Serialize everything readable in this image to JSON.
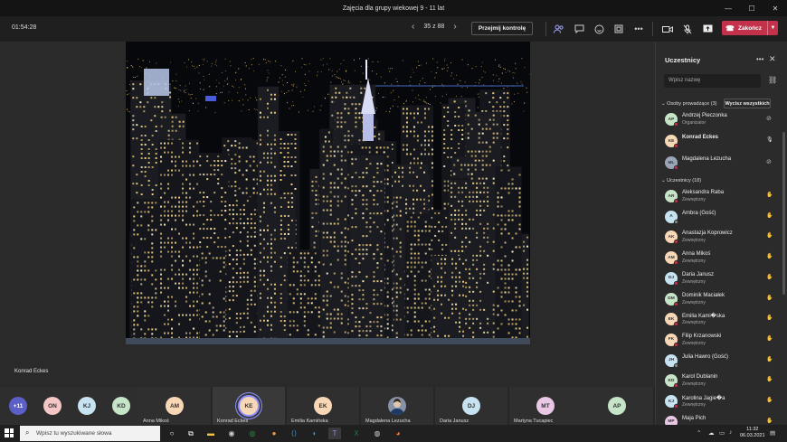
{
  "window": {
    "title": "Zajęcia dla grupy wiekowej 9 - 11 lat",
    "controls": {
      "minimize": "—",
      "maximize": "☐",
      "close": "✕"
    }
  },
  "toolbar": {
    "timer": "01:54:28",
    "page_indicator": "35 z 88",
    "take_control": "Przejmij kontrolę",
    "leave_label": "Zakończ",
    "colors": {
      "leave": "#c4314b"
    }
  },
  "stage": {
    "presenter_name": "Konrad Eckes"
  },
  "gallery": {
    "overflow": [
      {
        "initials": "+11",
        "color": "#5b5fc7"
      },
      {
        "initials": "ON",
        "color": "#f4c6c6"
      },
      {
        "initials": "KJ",
        "color": "#c7e2f0"
      },
      {
        "initials": "KD",
        "color": "#c6e4c8"
      }
    ],
    "tiles": [
      {
        "initials": "AM",
        "name": "Anna Mikoś",
        "color": "#f7d7b5"
      },
      {
        "initials": "KE",
        "name": "Konrad Eckes",
        "color": "#f7d7b5"
      },
      {
        "initials": "EK",
        "name": "Emilia Kamińska",
        "color": "#f7d7b5"
      },
      {
        "initials": "",
        "name": "Magdalena Lezucha",
        "color": "#9aa5b5"
      },
      {
        "initials": "DJ",
        "name": "Daria Janusz",
        "color": "#c7e2f0"
      },
      {
        "initials": "MT",
        "name": "Martyna Tucapiec",
        "color": "#e9c8e6"
      },
      {
        "initials": "AP",
        "name": "",
        "color": "#c6e4c8"
      }
    ]
  },
  "panel": {
    "title": "Uczestnicy",
    "search_placeholder": "Wpisz nazwę",
    "presenters_header": "Osoby prowadzące (3)",
    "mute_all": "Wycisz wszystkich",
    "attendees_header": "Uczestnicy (18)",
    "presenters": [
      {
        "initials": "AP",
        "name": "Andrzej Pieczonka",
        "role": "Organizator",
        "color": "#c6e4c8",
        "status": "#c4314b",
        "muted": true
      },
      {
        "initials": "KE",
        "name": "Konrad Eckes",
        "role": "",
        "color": "#f7d7b5",
        "status": "#c4314b",
        "muted": false,
        "bold": true
      },
      {
        "initials": "ML",
        "name": "Magdalena Lezucha",
        "role": "",
        "color": "#9aa5b5",
        "status": "#c4314b",
        "muted": true
      }
    ],
    "attendees": [
      {
        "initials": "AR",
        "name": "Aleksandra Raba",
        "role": "Zewnętrzny",
        "color": "#c6e4c8",
        "status": "#c4314b"
      },
      {
        "initials": "A",
        "name": "Ambra (Gość)",
        "role": "",
        "color": "#c7e2f0",
        "status": "#8a8a8a"
      },
      {
        "initials": "AK",
        "name": "Anastazja Koprowicz",
        "role": "Zewnętrzny",
        "color": "#f7d7b5",
        "status": "#c4314b"
      },
      {
        "initials": "AM",
        "name": "Anna Mikoś",
        "role": "Zewnętrzny",
        "color": "#f7d7b5",
        "status": "#c4314b"
      },
      {
        "initials": "DJ",
        "name": "Daria Janusz",
        "role": "Zewnętrzny",
        "color": "#c7e2f0",
        "status": "#c4314b"
      },
      {
        "initials": "DM",
        "name": "Dominik Maciałek",
        "role": "Zewnętrzny",
        "color": "#c6e4c8",
        "status": "#c4314b"
      },
      {
        "initials": "EK",
        "name": "Emilia Kami�ska",
        "role": "Zewnętrzny",
        "color": "#f7d7b5",
        "status": "#c4314b"
      },
      {
        "initials": "FK",
        "name": "Filip Krzanowski",
        "role": "Zewnętrzny",
        "color": "#f7d7b5",
        "status": "#c4314b"
      },
      {
        "initials": "JH",
        "name": "Julia Hawro (Gość)",
        "role": "",
        "color": "#c7e2f0",
        "status": "#8a8a8a"
      },
      {
        "initials": "KD",
        "name": "Karol Dublanin",
        "role": "Zewnętrzny",
        "color": "#c6e4c8",
        "status": "#c4314b"
      },
      {
        "initials": "KJ",
        "name": "Karolina Jagie�a",
        "role": "Zewnętrzny",
        "color": "#c7e2f0",
        "status": "#c4314b"
      },
      {
        "initials": "MP",
        "name": "Maja Pich",
        "role": "",
        "color": "#e9c8e6",
        "status": "#c4314b"
      }
    ]
  },
  "taskbar": {
    "search_placeholder": "Wpisz tu wyszukiwane słowa",
    "time": "11:32",
    "date": "06.03.2021"
  }
}
